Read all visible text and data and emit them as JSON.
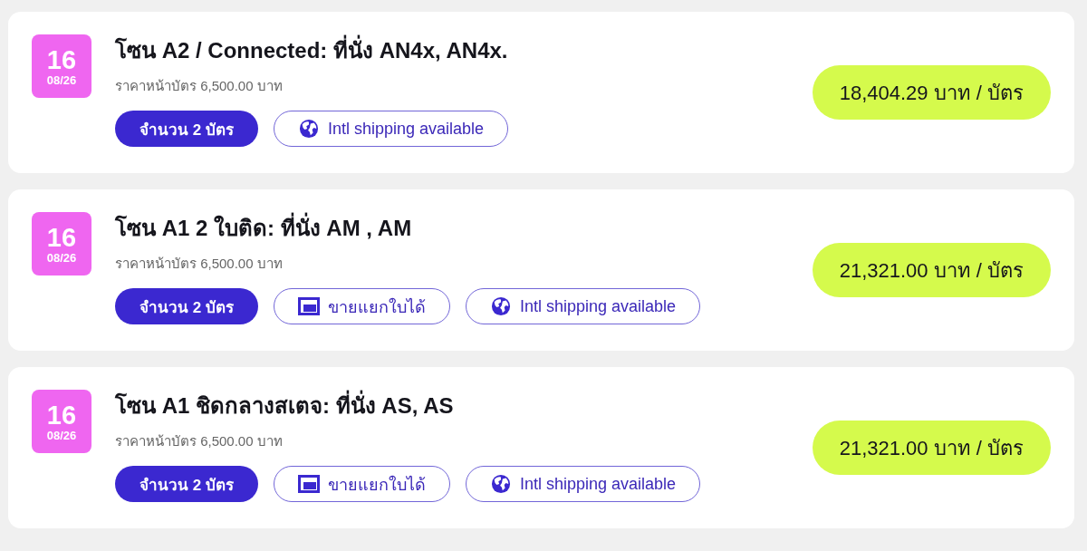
{
  "listings": [
    {
      "date": {
        "day": "16",
        "month_year": "08/26"
      },
      "title": "โซน A2 / Connected: ที่นั่ง AN4x, AN4x.",
      "face_value": "ราคาหน้าบัตร 6,500.00 บาท",
      "quantity": "จำนวน 2 บัตร",
      "tags": [
        {
          "kind": "intl",
          "label": "Intl shipping available"
        }
      ],
      "price": "18,404.29 บาท / บัตร"
    },
    {
      "date": {
        "day": "16",
        "month_year": "08/26"
      },
      "title": "โซน A1 2 ใบติด: ที่นั่ง AM , AM",
      "face_value": "ราคาหน้าบัตร 6,500.00 บาท",
      "quantity": "จำนวน 2 บัตร",
      "tags": [
        {
          "kind": "split",
          "label": "ขายแยกใบได้"
        },
        {
          "kind": "intl",
          "label": "Intl shipping available"
        }
      ],
      "price": "21,321.00 บาท / บัตร"
    },
    {
      "date": {
        "day": "16",
        "month_year": "08/26"
      },
      "title": "โซน A1 ชิดกลางสเตจ: ที่นั่ง AS, AS",
      "face_value": "ราคาหน้าบัตร 6,500.00 บาท",
      "quantity": "จำนวน 2 บัตร",
      "tags": [
        {
          "kind": "split",
          "label": "ขายแยกใบได้"
        },
        {
          "kind": "intl",
          "label": "Intl shipping available"
        }
      ],
      "price": "21,321.00 บาท / บัตร"
    }
  ]
}
